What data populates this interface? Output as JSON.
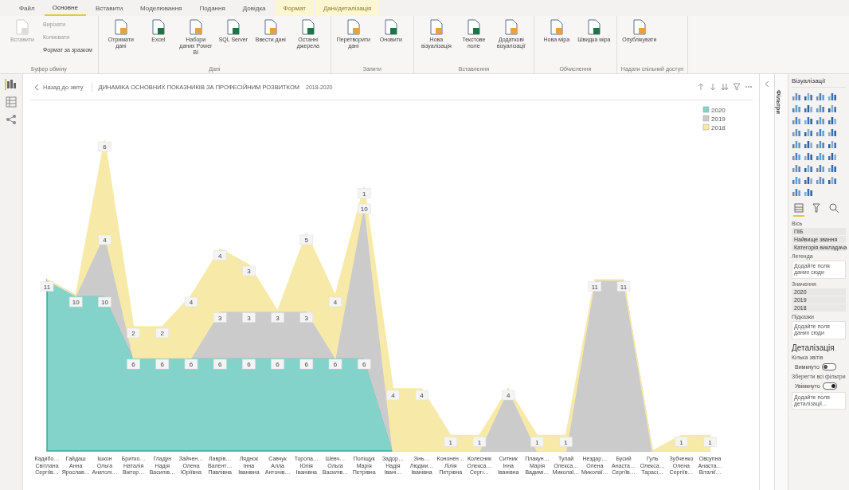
{
  "ribbon_tabs": [
    {
      "label": "Файл",
      "selected": false,
      "contextual": false
    },
    {
      "label": "Основне",
      "selected": true,
      "contextual": false
    },
    {
      "label": "Вставити",
      "selected": false,
      "contextual": false
    },
    {
      "label": "Моделювання",
      "selected": false,
      "contextual": false
    },
    {
      "label": "Подання",
      "selected": false,
      "contextual": false
    },
    {
      "label": "Довідка",
      "selected": false,
      "contextual": false
    },
    {
      "label": "Формат",
      "selected": false,
      "contextual": true
    },
    {
      "label": "Дані/деталізація",
      "selected": false,
      "contextual": true
    }
  ],
  "ribbon_groups": [
    {
      "label": "Буфер обміну",
      "buttons": [
        {
          "label": "Вставити",
          "kind": "large",
          "disabled": true
        },
        {
          "label": "Вирізати",
          "kind": "small",
          "disabled": true
        },
        {
          "label": "Копіювати",
          "kind": "small",
          "disabled": true
        },
        {
          "label": "Формат за зразком",
          "kind": "small",
          "disabled": false
        }
      ]
    },
    {
      "label": "Дані",
      "buttons": [
        {
          "label": "Отримати дані",
          "kind": "large",
          "disabled": false
        },
        {
          "label": "Excel",
          "kind": "large",
          "disabled": false
        },
        {
          "label": "Набори даних Power BI",
          "kind": "large",
          "disabled": false
        },
        {
          "label": "SQL Server",
          "kind": "large",
          "disabled": false
        },
        {
          "label": "Ввести дані",
          "kind": "large",
          "disabled": false
        },
        {
          "label": "Останні джерела",
          "kind": "large",
          "disabled": false
        }
      ]
    },
    {
      "label": "Запити",
      "buttons": [
        {
          "label": "Перетворити дані",
          "kind": "large",
          "disabled": false
        },
        {
          "label": "Оновити",
          "kind": "large",
          "disabled": false
        }
      ]
    },
    {
      "label": "Вставлення",
      "buttons": [
        {
          "label": "Нова візуалізація",
          "kind": "large",
          "disabled": false
        },
        {
          "label": "Текстове поле",
          "kind": "large",
          "disabled": false
        },
        {
          "label": "Додаткові візуалізації",
          "kind": "large",
          "disabled": false
        }
      ]
    },
    {
      "label": "Обчислення",
      "buttons": [
        {
          "label": "Нова міра",
          "kind": "large",
          "disabled": false
        },
        {
          "label": "Швидка міра",
          "kind": "large",
          "disabled": false
        }
      ]
    },
    {
      "label": "Надати спільний доступ",
      "buttons": [
        {
          "label": "Опублікувати",
          "kind": "large",
          "disabled": false
        }
      ]
    }
  ],
  "back_button": "Назад до звіту",
  "report_title": "ДИНАМІКА ОСНОВНИХ ПОКАЗНИКІВ ЗА ПРОФЕСІЙНИМ РОЗВИТКОМ",
  "report_subtitle": "2018-2020",
  "chart_data": {
    "type": "area",
    "stacked": true,
    "legend": "top-right",
    "categories": [
      "Кадибо… Світлана Сергіїв…",
      "Гайдаш Анна Ярослав…",
      "Ішкон Ольга Анатолі…",
      "Бритко… Наталія Віктор…",
      "Гладун Надія Василів…",
      "Зайчен… Олена Юріївна",
      "Лаврів… Валент… Павлівна",
      "Ляднок Інна Іванівна",
      "Савчук Алла Антонів…",
      "Торопа… Юлія Іванівна",
      "Шевч… Ольга Василів…",
      "Поліщук Марія Петрівна",
      "Задор… Надія Івані…",
      "Зінь… Людми… Іванівна",
      "Кононен… Лілія Петрівна",
      "Колесник Олекса… Сергі…",
      "Ситник Інна Іванівна",
      "Плакун… Марія Вадимі…",
      "Тулай Олекса… Миколаї…",
      "Нездар… Олена Миколаї…",
      "Бусий Анаста… Сергіїв…",
      "Гуль Олекса… Тарасі…",
      "Зубченко Олена Сергіїв…",
      "Овсупна Анаста… Віталії…"
    ],
    "series": [
      {
        "name": "2020",
        "color": "#84d3cb",
        "values": [
          11,
          10,
          10,
          6,
          6,
          6,
          6,
          6,
          6,
          6,
          6,
          6,
          0,
          0,
          0,
          0,
          0,
          0,
          0,
          0,
          0,
          0,
          0,
          0
        ],
        "value_labels": [
          "11",
          "10",
          "10",
          "6",
          "6",
          "6",
          "6",
          "6",
          "6",
          "6",
          "6",
          "6",
          null,
          null,
          null,
          null,
          null,
          null,
          null,
          null,
          null,
          null,
          null,
          null
        ]
      },
      {
        "name": "2019",
        "color": "#cbcbcb",
        "values": [
          0,
          0,
          4,
          0,
          0,
          0,
          3,
          3,
          3,
          3,
          0,
          10,
          0,
          0,
          0,
          0,
          4,
          0,
          0,
          11,
          11,
          0,
          0,
          0
        ],
        "value_labels": [
          null,
          null,
          "4",
          null,
          null,
          null,
          "3",
          "3",
          "3",
          "3",
          null,
          "10",
          null,
          null,
          null,
          null,
          "4",
          null,
          null,
          "11",
          "11",
          null,
          null,
          null
        ]
      },
      {
        "name": "2018",
        "color": "#f7eaa9",
        "values": [
          0,
          0,
          6,
          2,
          2,
          4,
          4,
          3,
          0,
          5,
          4,
          1,
          4,
          4,
          1,
          1,
          0,
          1,
          1,
          0,
          0,
          0,
          1,
          1
        ],
        "value_labels": [
          null,
          null,
          "6",
          "2",
          "2",
          "4",
          "4",
          "3",
          null,
          "5",
          "4",
          "1",
          "4",
          "4",
          "1",
          "1",
          null,
          "1",
          "1",
          null,
          null,
          null,
          "1",
          "1"
        ]
      }
    ]
  },
  "fields_pane": {
    "title": "Візуалізації",
    "filters_tab": "Фільтри",
    "pane_tabs": [
      {
        "kind": "fields",
        "selected": true
      },
      {
        "kind": "format",
        "selected": false
      },
      {
        "kind": "analytics",
        "selected": false
      }
    ],
    "wells": [
      {
        "title": "Вісь",
        "items": [
          "ПІБ",
          "Найвище звання",
          "Категорія викладача"
        ]
      },
      {
        "title": "Легенда",
        "placeholder": "Додайте поля даних сюди"
      },
      {
        "title": "Значення",
        "items": [
          "2020",
          "2019",
          "2018"
        ]
      },
      {
        "title": "Підказки",
        "placeholder": "Додайте поля даних сюди"
      }
    ],
    "drillthrough": {
      "title": "Деталізація",
      "toggles": [
        {
          "label": "Кілька звітів",
          "text": "Вимкнуто",
          "on": false
        },
        {
          "label": "Зберегти всі фільтри",
          "text": "Увімкнуто",
          "on": true
        }
      ],
      "placeholder": "Додайте поля деталізації..."
    }
  }
}
